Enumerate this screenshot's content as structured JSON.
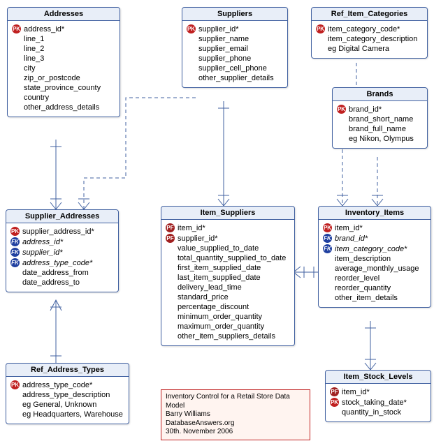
{
  "entities": {
    "addresses": {
      "title": "Addresses",
      "fields": [
        {
          "key": "pk",
          "text": "address_id*"
        },
        {
          "key": "",
          "text": "line_1"
        },
        {
          "key": "",
          "text": "line_2"
        },
        {
          "key": "",
          "text": "line_3"
        },
        {
          "key": "",
          "text": "city"
        },
        {
          "key": "",
          "text": "zip_or_postcode"
        },
        {
          "key": "",
          "text": "state_province_county"
        },
        {
          "key": "",
          "text": "country"
        },
        {
          "key": "",
          "text": "other_address_details"
        }
      ]
    },
    "suppliers": {
      "title": "Suppliers",
      "fields": [
        {
          "key": "pk",
          "text": "supplier_id*"
        },
        {
          "key": "",
          "text": "supplier_name"
        },
        {
          "key": "",
          "text": "supplier_email"
        },
        {
          "key": "",
          "text": "supplier_phone"
        },
        {
          "key": "",
          "text": "supplier_cell_phone"
        },
        {
          "key": "",
          "text": "other_supplier_details"
        }
      ]
    },
    "ref_item_categories": {
      "title": "Ref_Item_Categories",
      "fields": [
        {
          "key": "pk",
          "text": "item_category_code*"
        },
        {
          "key": "",
          "text": "item_category_description"
        },
        {
          "key": "",
          "text": "eg Digital Camera"
        }
      ]
    },
    "brands": {
      "title": "Brands",
      "fields": [
        {
          "key": "pk",
          "text": "brand_id*"
        },
        {
          "key": "",
          "text": "brand_short_name"
        },
        {
          "key": "",
          "text": "brand_full_name"
        },
        {
          "key": "",
          "text": "eg Nikon, Olympus"
        }
      ]
    },
    "supplier_addresses": {
      "title": "Supplier_Addresses",
      "fields": [
        {
          "key": "pk",
          "text": "supplier_address_id*"
        },
        {
          "key": "fk",
          "text": "address_id*",
          "italic": true
        },
        {
          "key": "fk",
          "text": "supplier_id*",
          "italic": true
        },
        {
          "key": "fk",
          "text": "address_type_code*",
          "italic": true
        },
        {
          "key": "",
          "text": "date_address_from"
        },
        {
          "key": "",
          "text": "date_address_to"
        }
      ]
    },
    "item_suppliers": {
      "title": "Item_Suppliers",
      "fields": [
        {
          "key": "pf",
          "text": "item_id*"
        },
        {
          "key": "pf",
          "text": "supplier_id*"
        },
        {
          "key": "",
          "text": "value_supplied_to_date"
        },
        {
          "key": "",
          "text": "total_quantity_supplied_to_date"
        },
        {
          "key": "",
          "text": "first_item_supplied_date"
        },
        {
          "key": "",
          "text": "last_item_supplied_date"
        },
        {
          "key": "",
          "text": "delivery_lead_time"
        },
        {
          "key": "",
          "text": "standard_price"
        },
        {
          "key": "",
          "text": "percentage_discount"
        },
        {
          "key": "",
          "text": "minimum_order_quantity"
        },
        {
          "key": "",
          "text": "maximum_order_quantity"
        },
        {
          "key": "",
          "text": "other_item_suppliers_details"
        }
      ]
    },
    "inventory_items": {
      "title": "Inventory_Items",
      "fields": [
        {
          "key": "pk",
          "text": "item_id*"
        },
        {
          "key": "fk",
          "text": "brand_id*",
          "italic": true
        },
        {
          "key": "fk",
          "text": "item_category_code*",
          "italic": true
        },
        {
          "key": "",
          "text": "item_description"
        },
        {
          "key": "",
          "text": "average_monthly_usage"
        },
        {
          "key": "",
          "text": "reorder_level"
        },
        {
          "key": "",
          "text": "reorder_quantity"
        },
        {
          "key": "",
          "text": "other_item_details"
        }
      ]
    },
    "ref_address_types": {
      "title": "Ref_Address_Types",
      "fields": [
        {
          "key": "pk",
          "text": "address_type_code*"
        },
        {
          "key": "",
          "text": "address_type_description"
        },
        {
          "key": "",
          "text": "eg General, Unknown"
        },
        {
          "key": "",
          "text": "eg Headquarters, Warehouse"
        }
      ]
    },
    "item_stock_levels": {
      "title": "Item_Stock_Levels",
      "fields": [
        {
          "key": "pf",
          "text": "item_id*"
        },
        {
          "key": "pk",
          "text": "stock_taking_date*"
        },
        {
          "key": "",
          "text": "quantity_in_stock"
        }
      ]
    }
  },
  "info": {
    "line1": "Inventory Control for a Retail Store Data",
    "line2": "Model",
    "line3": "Barry Williams",
    "line4": "DatabaseAnswers.org",
    "line5": "30th. November 2006"
  },
  "key_labels": {
    "pk": "PK",
    "fk": "FK",
    "pf": "PF"
  }
}
